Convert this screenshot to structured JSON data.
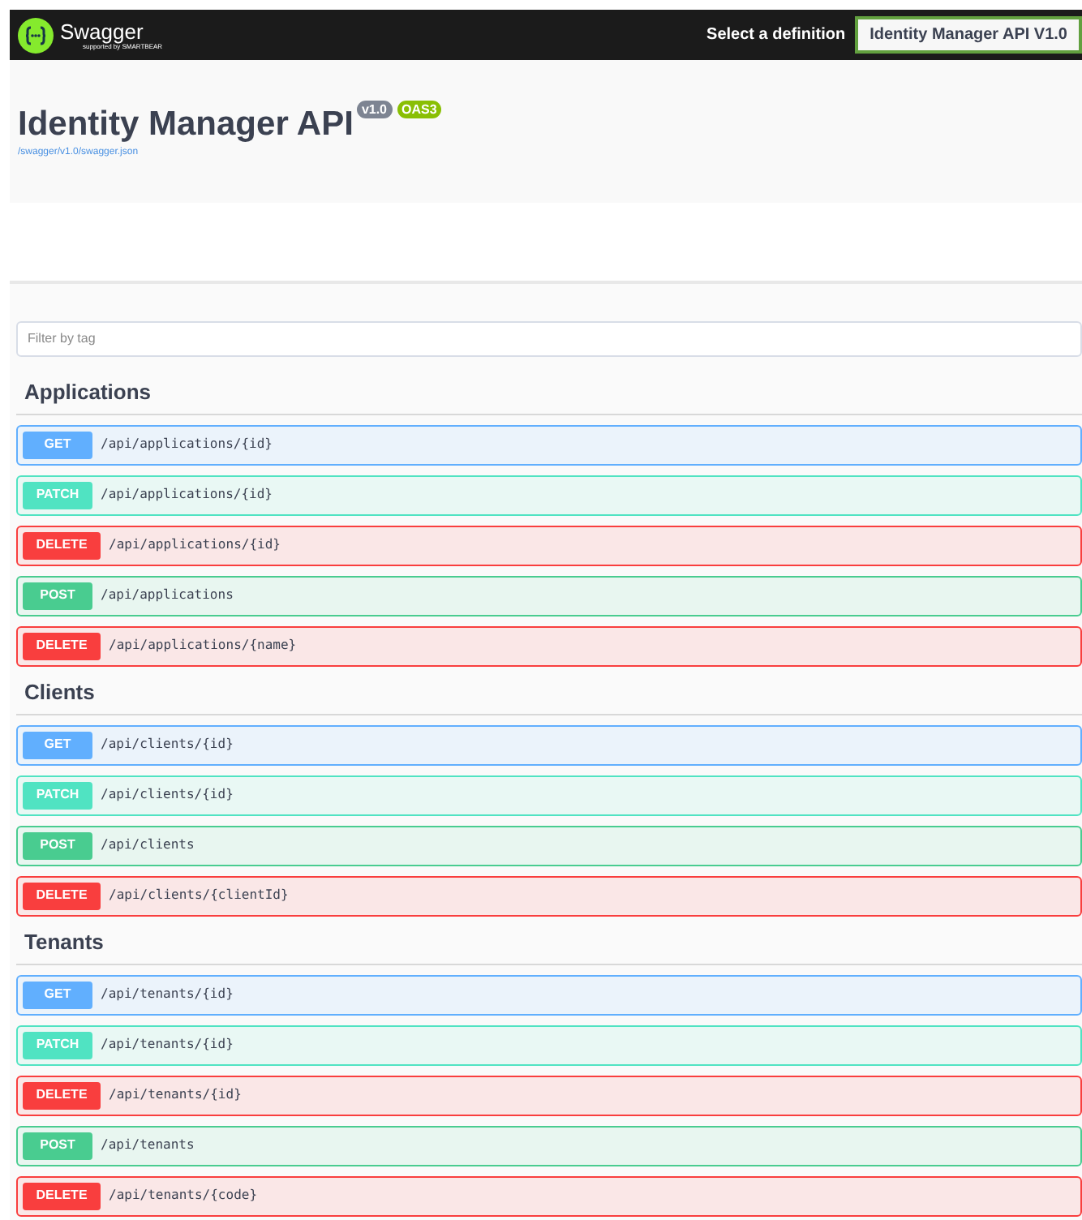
{
  "topbar": {
    "logo_text": "Swagger",
    "logo_subtext": "supported by SMARTBEAR",
    "definition_label": "Select a definition",
    "definition_value": "Identity Manager API V1.0"
  },
  "info": {
    "title": "Identity Manager API",
    "version": "v1.0",
    "oas": "OAS3",
    "spec_link": "/swagger/v1.0/swagger.json"
  },
  "filter": {
    "placeholder": "Filter by tag"
  },
  "sections": [
    {
      "name": "Applications",
      "operations": [
        {
          "kind": "get",
          "method": "GET",
          "path": "/api/applications/{id}"
        },
        {
          "kind": "patch",
          "method": "PATCH",
          "path": "/api/applications/{id}"
        },
        {
          "kind": "delete",
          "method": "DELETE",
          "path": "/api/applications/{id}"
        },
        {
          "kind": "post",
          "method": "POST",
          "path": "/api/applications"
        },
        {
          "kind": "delete",
          "method": "DELETE",
          "path": "/api/applications/{name}"
        }
      ]
    },
    {
      "name": "Clients",
      "operations": [
        {
          "kind": "get",
          "method": "GET",
          "path": "/api/clients/{id}"
        },
        {
          "kind": "patch",
          "method": "PATCH",
          "path": "/api/clients/{id}"
        },
        {
          "kind": "post",
          "method": "POST",
          "path": "/api/clients"
        },
        {
          "kind": "delete",
          "method": "DELETE",
          "path": "/api/clients/{clientId}"
        }
      ]
    },
    {
      "name": "Tenants",
      "operations": [
        {
          "kind": "get",
          "method": "GET",
          "path": "/api/tenants/{id}"
        },
        {
          "kind": "patch",
          "method": "PATCH",
          "path": "/api/tenants/{id}"
        },
        {
          "kind": "delete",
          "method": "DELETE",
          "path": "/api/tenants/{id}"
        },
        {
          "kind": "post",
          "method": "POST",
          "path": "/api/tenants"
        },
        {
          "kind": "delete",
          "method": "DELETE",
          "path": "/api/tenants/{code}"
        }
      ]
    }
  ]
}
